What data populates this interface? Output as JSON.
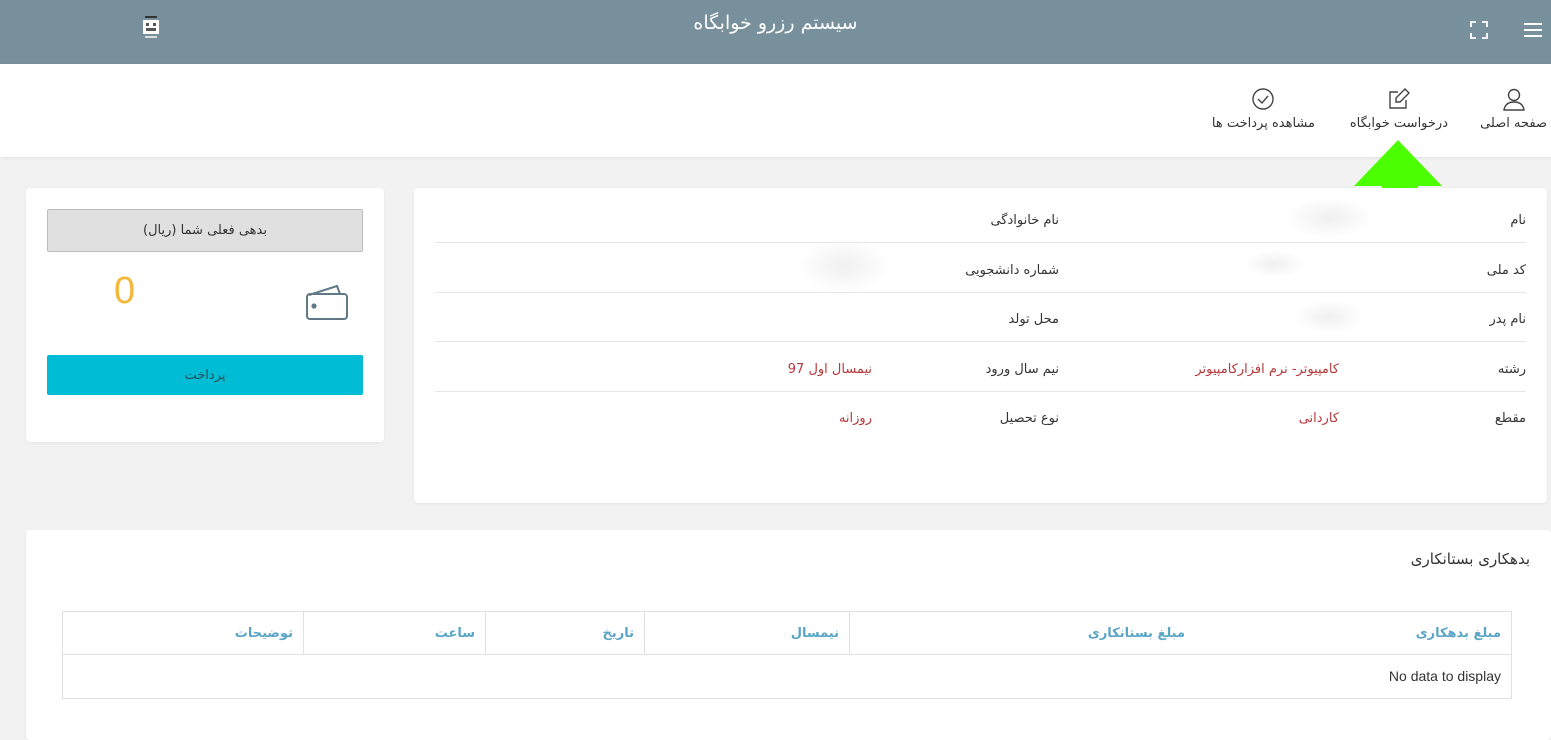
{
  "header": {
    "title": "سیستم رزرو خوابگاه"
  },
  "nav": {
    "items": [
      {
        "label": "صفحه اصلی",
        "icon": "user-icon"
      },
      {
        "label": "درخواست خوابگاه",
        "icon": "edit-icon"
      },
      {
        "label": "مشاهده پرداخت ها",
        "icon": "check-circle-icon"
      }
    ]
  },
  "annotation": {
    "color": "#4cff00",
    "icon": "up-arrow"
  },
  "balance": {
    "header": "بدهی فعلی شما (ریال)",
    "value": "0",
    "pay_label": "پرداخت",
    "value_color": "#f4b73a",
    "button_color": "#00bcd4"
  },
  "profile": {
    "rows": [
      {
        "label1": "نام",
        "value1": "",
        "label2": "نام خانوادگی",
        "value2": ""
      },
      {
        "label1": "کد ملی",
        "value1": "",
        "label2": "شماره دانشجویی",
        "value2": ""
      },
      {
        "label1": "نام پدر",
        "value1": "",
        "label2": "محل تولد",
        "value2": ""
      },
      {
        "label1": "رشته",
        "value1": "کامپیوتر- نرم افزارکامپیوتر",
        "label2": "نیم سال ورود",
        "value2": "نیمسال اول 97"
      },
      {
        "label1": "مقطع",
        "value1": "کاردانی",
        "label2": "نوع تحصیل",
        "value2": "روزانه"
      }
    ]
  },
  "debt": {
    "title": "بدهکاری بستانکاری",
    "columns": [
      "مبلغ بدهکاری",
      "مبلغ بستانکاری",
      "نیمسال",
      "تاریخ",
      "ساعت",
      "توضیحات"
    ],
    "empty_text": "No data to display"
  }
}
